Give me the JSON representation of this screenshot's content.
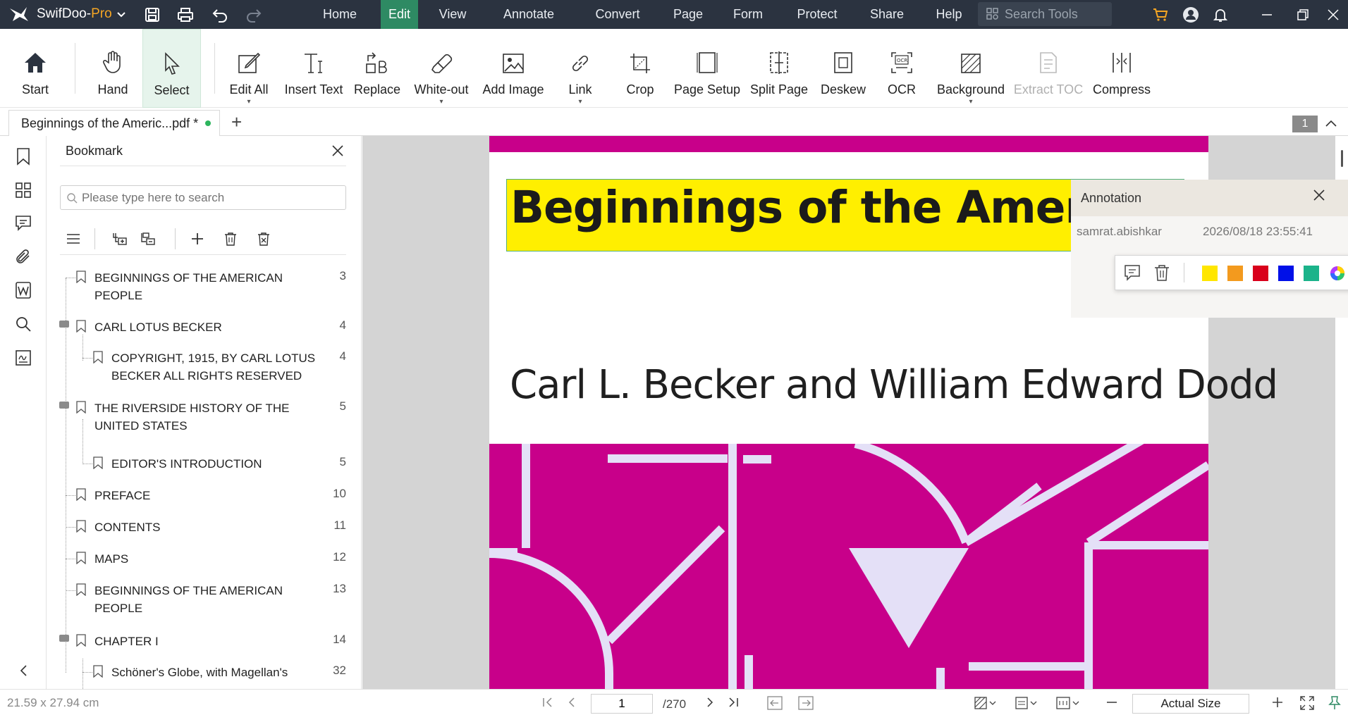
{
  "app": {
    "name_main": "SwifDoo-",
    "name_suffix": "Pro",
    "menus": [
      {
        "label": "Home"
      },
      {
        "label": "Edit"
      },
      {
        "label": "View"
      },
      {
        "label": "Annotate"
      },
      {
        "label": "Convert"
      },
      {
        "label": "Page"
      },
      {
        "label": "Form"
      },
      {
        "label": "Protect"
      },
      {
        "label": "Share"
      },
      {
        "label": "Help"
      }
    ],
    "search_placeholder": "Search Tools",
    "colors": {
      "titlebar": "#2b3340",
      "active_menu": "#2e8a63",
      "accent_orange": "#f5a623"
    }
  },
  "ribbon": {
    "tools": [
      {
        "label": "Start",
        "icon": "home-icon"
      },
      {
        "label": "Hand",
        "icon": "hand-icon"
      },
      {
        "label": "Select",
        "icon": "cursor-icon"
      },
      {
        "label": "Edit All",
        "icon": "edit-all-icon"
      },
      {
        "label": "Insert Text",
        "icon": "insert-text-icon"
      },
      {
        "label": "Replace",
        "icon": "replace-icon"
      },
      {
        "label": "White-out",
        "icon": "eraser-icon"
      },
      {
        "label": "Add Image",
        "icon": "image-icon"
      },
      {
        "label": "Link",
        "icon": "link-icon"
      },
      {
        "label": "Crop",
        "icon": "crop-icon"
      },
      {
        "label": "Page Setup",
        "icon": "page-setup-icon"
      },
      {
        "label": "Split Page",
        "icon": "split-page-icon"
      },
      {
        "label": "Deskew",
        "icon": "deskew-icon"
      },
      {
        "label": "OCR",
        "icon": "ocr-icon"
      },
      {
        "label": "Background",
        "icon": "background-icon"
      },
      {
        "label": "Extract TOC",
        "icon": "extract-toc-icon"
      },
      {
        "label": "Compress",
        "icon": "compress-icon"
      }
    ]
  },
  "tabs": {
    "doc_tab": "Beginnings of the Americ...pdf *",
    "add": "+",
    "page_badge": "1"
  },
  "bookmark": {
    "title": "Bookmark",
    "search_placeholder": "Please type here to search",
    "items": [
      {
        "line1": "BEGINNINGS OF THE AMERICAN",
        "line2": "PEOPLE",
        "page": "3"
      },
      {
        "line1": "CARL LOTUS BECKER",
        "line2": "",
        "page": "4"
      },
      {
        "line1": "COPYRIGHT, 1915, BY CARL LOTUS",
        "line2": "BECKER ALL RIGHTS RESERVED",
        "page": "4"
      },
      {
        "line1": "THE RIVERSIDE HISTORY OF THE",
        "line2": "UNITED STATES",
        "page": "5"
      },
      {
        "line1": "EDITOR'S INTRODUCTION",
        "line2": "",
        "page": "5"
      },
      {
        "line1": "PREFACE",
        "line2": "",
        "page": "10"
      },
      {
        "line1": "CONTENTS",
        "line2": "",
        "page": "11"
      },
      {
        "line1": "MAPS",
        "line2": "",
        "page": "12"
      },
      {
        "line1": "BEGINNINGS OF THE AMERICAN",
        "line2": "PEOPLE",
        "page": "13"
      },
      {
        "line1": "CHAPTER I",
        "line2": "",
        "page": "14"
      },
      {
        "line1": "Schöner's Globe, with Magellan's",
        "line2": "",
        "page": "32"
      }
    ]
  },
  "document": {
    "title": "Beginnings of the American P",
    "author": "Carl L. Becker and William Edward Dodd",
    "colors": {
      "cover_magenta": "#c8008a",
      "highlight": "#ffef00",
      "shapes": "#e4e0f7"
    }
  },
  "annotation": {
    "title": "Annotation",
    "user": "samrat.abishkar",
    "datetime": "2026/08/18 23:55:41",
    "swatches": [
      "#ffe600",
      "#f39a1e",
      "#d9001b",
      "#0010e8",
      "#1bb38a"
    ]
  },
  "status": {
    "page_size": "21.59 x 27.94 cm",
    "current_page": "1",
    "total_pages": "/270",
    "zoom": "Actual Size"
  }
}
